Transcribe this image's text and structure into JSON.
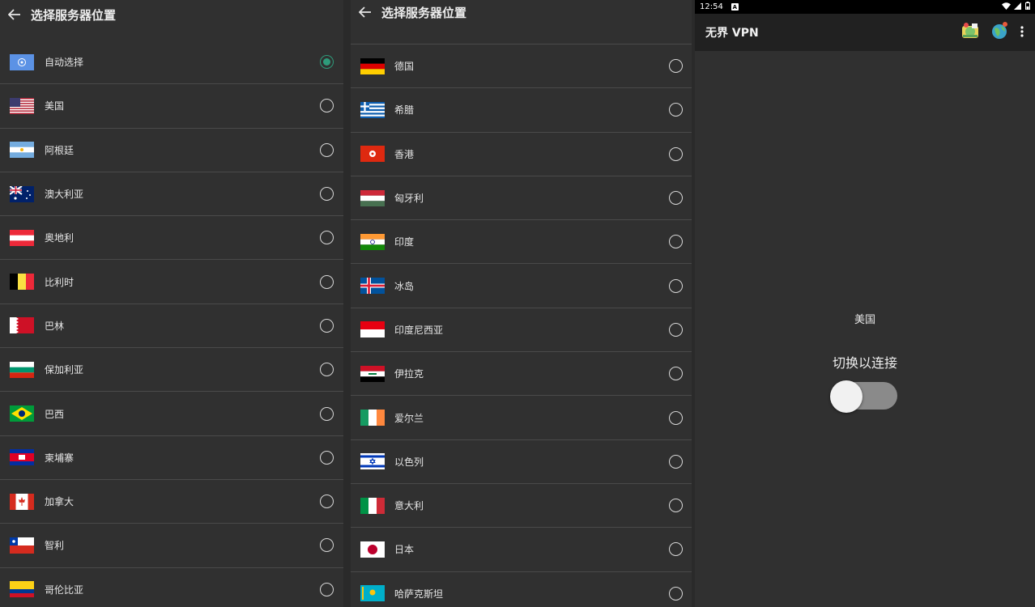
{
  "left_panel": {
    "title": "选择服务器位置",
    "items": [
      {
        "label": "自动选择",
        "flag": "un-flag-icon",
        "selected": true
      },
      {
        "label": "美国",
        "flag": "us-flag-icon",
        "selected": false
      },
      {
        "label": "阿根廷",
        "flag": "argentina-flag-icon",
        "selected": false
      },
      {
        "label": "澳大利亚",
        "flag": "australia-flag-icon",
        "selected": false
      },
      {
        "label": "奥地利",
        "flag": "austria-flag-icon",
        "selected": false
      },
      {
        "label": "比利时",
        "flag": "belgium-flag-icon",
        "selected": false
      },
      {
        "label": "巴林",
        "flag": "bahrain-flag-icon",
        "selected": false
      },
      {
        "label": "保加利亚",
        "flag": "bulgaria-flag-icon",
        "selected": false
      },
      {
        "label": "巴西",
        "flag": "brazil-flag-icon",
        "selected": false
      },
      {
        "label": "柬埔寨",
        "flag": "cambodia-flag-icon",
        "selected": false
      },
      {
        "label": "加拿大",
        "flag": "canada-flag-icon",
        "selected": false
      },
      {
        "label": "智利",
        "flag": "chile-flag-icon",
        "selected": false
      },
      {
        "label": "哥伦比亚",
        "flag": "colombia-flag-icon",
        "selected": false
      }
    ]
  },
  "middle_panel": {
    "title": "选择服务器位置",
    "items": [
      {
        "label": "德国",
        "flag": "germany-flag-icon",
        "selected": false
      },
      {
        "label": "希腊",
        "flag": "greece-flag-icon",
        "selected": false
      },
      {
        "label": "香港",
        "flag": "hongkong-flag-icon",
        "selected": false
      },
      {
        "label": "匈牙利",
        "flag": "hungary-flag-icon",
        "selected": false
      },
      {
        "label": "印度",
        "flag": "india-flag-icon",
        "selected": false
      },
      {
        "label": "冰岛",
        "flag": "iceland-flag-icon",
        "selected": false
      },
      {
        "label": "印度尼西亚",
        "flag": "indonesia-flag-icon",
        "selected": false
      },
      {
        "label": "伊拉克",
        "flag": "iraq-flag-icon",
        "selected": false
      },
      {
        "label": "爱尔兰",
        "flag": "ireland-flag-icon",
        "selected": false
      },
      {
        "label": "以色列",
        "flag": "israel-flag-icon",
        "selected": false
      },
      {
        "label": "意大利",
        "flag": "italy-flag-icon",
        "selected": false
      },
      {
        "label": "日本",
        "flag": "japan-flag-icon",
        "selected": false
      },
      {
        "label": "哈萨克斯坦",
        "flag": "kazakhstan-flag-icon",
        "selected": false
      }
    ]
  },
  "right_panel": {
    "status_time": "12:54",
    "status_badge": "A",
    "app_title": "无界 VPN",
    "location": "美国",
    "toggle_label": "切换以连接",
    "toggle_on": false
  }
}
